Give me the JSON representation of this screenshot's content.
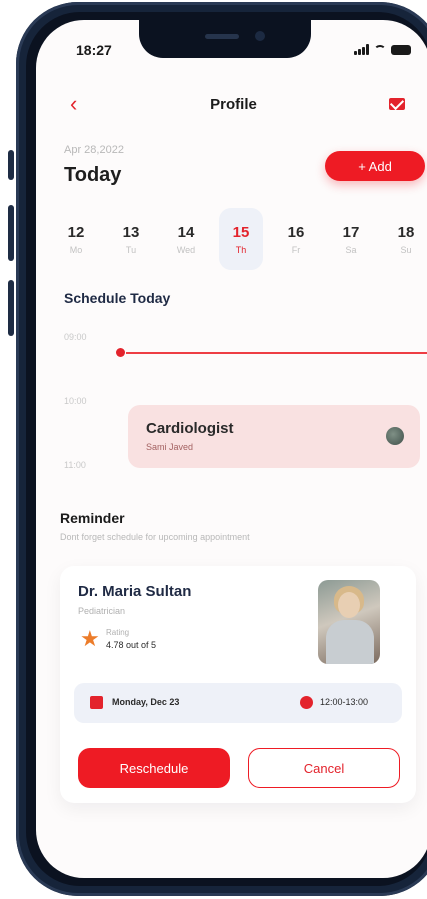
{
  "status": {
    "time": "18:27"
  },
  "header": {
    "title": "Profile"
  },
  "date": {
    "small": "Apr 28,2022",
    "big": "Today",
    "add_label": "+ Add"
  },
  "week": [
    {
      "num": "12",
      "wd": "Mo"
    },
    {
      "num": "13",
      "wd": "Tu"
    },
    {
      "num": "14",
      "wd": "Wed"
    },
    {
      "num": "15",
      "wd": "Th"
    },
    {
      "num": "16",
      "wd": "Fr"
    },
    {
      "num": "17",
      "wd": "Sa"
    },
    {
      "num": "18",
      "wd": "Su"
    }
  ],
  "schedule": {
    "title": "Schedule Today",
    "times": [
      "09:00",
      "10:00",
      "11:00"
    ],
    "appointment": {
      "name": "Cardiologist",
      "sub": "Sami Javed"
    }
  },
  "reminder": {
    "title": "Reminder",
    "subtitle": "Dont forget schedule for upcoming appointment",
    "doctor": {
      "name": "Dr. Maria Sultan",
      "specialty": "Pediatrician",
      "rating_label": "Rating",
      "rating_value": "4.78 out of 5"
    },
    "date": "Monday, Dec 23",
    "time": "12:00-13:00",
    "reschedule_label": "Reschedule",
    "cancel_label": "Cancel"
  },
  "colors": {
    "accent": "#ee1b24",
    "appt_bg": "#f9e1e1",
    "chip_bg": "#eef1f8"
  }
}
